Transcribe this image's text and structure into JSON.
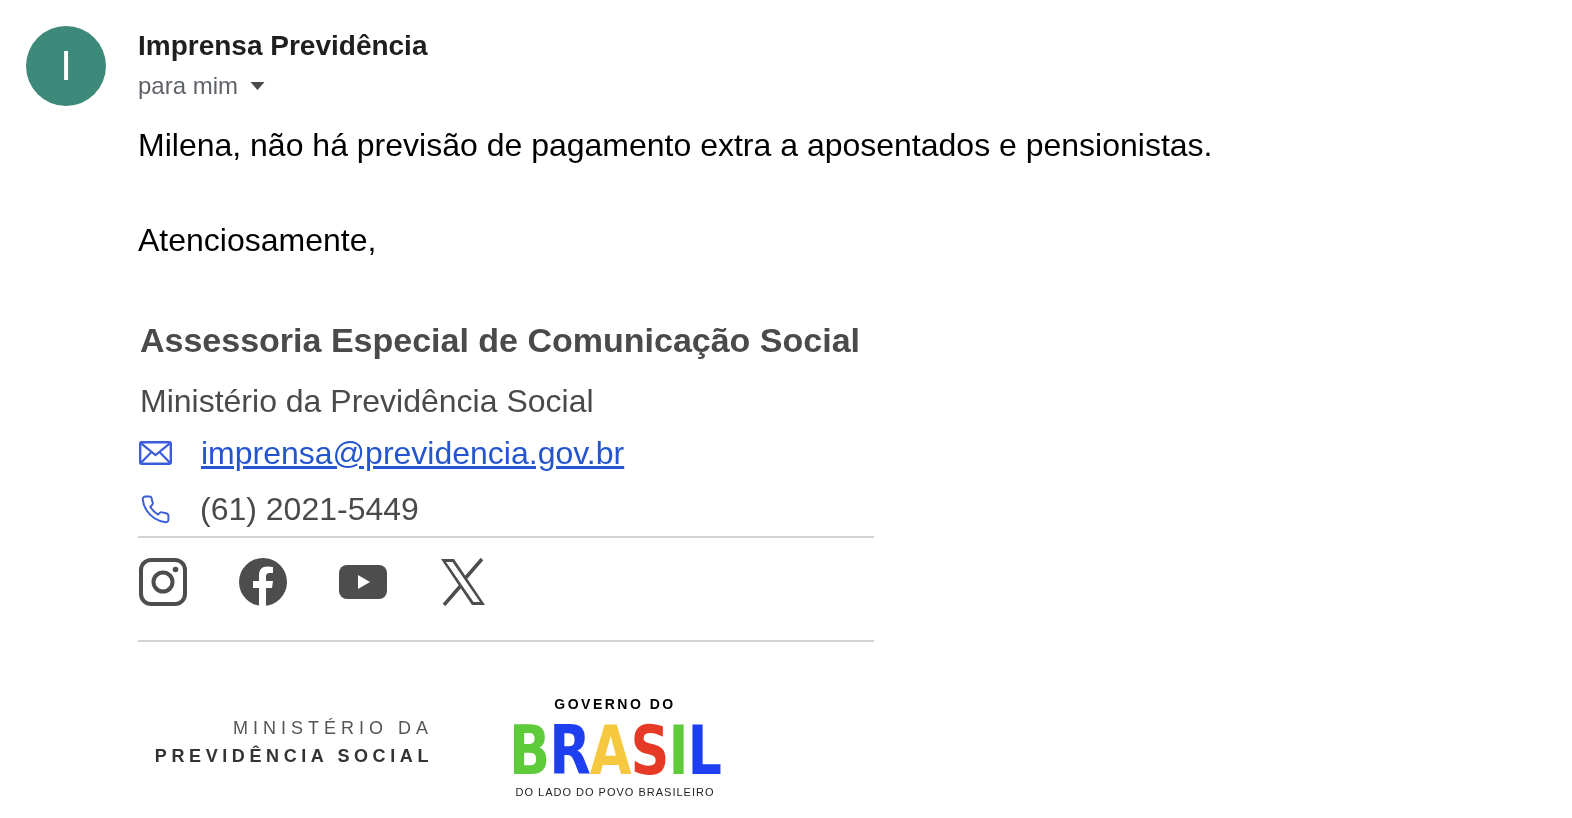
{
  "message": {
    "sender": {
      "avatar_letter": "I",
      "name": "Imprensa Previdência"
    },
    "recipient": "para mim",
    "body": [
      "Milena, não há previsão de pagamento extra a aposentados e pensionistas.",
      "Atenciosamente,"
    ]
  },
  "signature": {
    "title": "Assessoria Especial de Comunicação Social",
    "organization": "Ministério da Previdência Social",
    "contacts": [
      {
        "kind": "email",
        "text": "imprensa@previdencia.gov.br"
      },
      {
        "kind": "phone",
        "text": "(61) 2021-5449"
      }
    ],
    "logos": [
      {
        "kind": "ministry",
        "lines": [
          "MINISTÉRIO DA",
          "PREVIDÊNCIA SOCIAL"
        ]
      },
      {
        "kind": "government",
        "top": "GOVERNO DO",
        "wordmark": "BRASIL",
        "tagline": "DO LADO DO POVO BRASILEIRO"
      }
    ]
  }
}
